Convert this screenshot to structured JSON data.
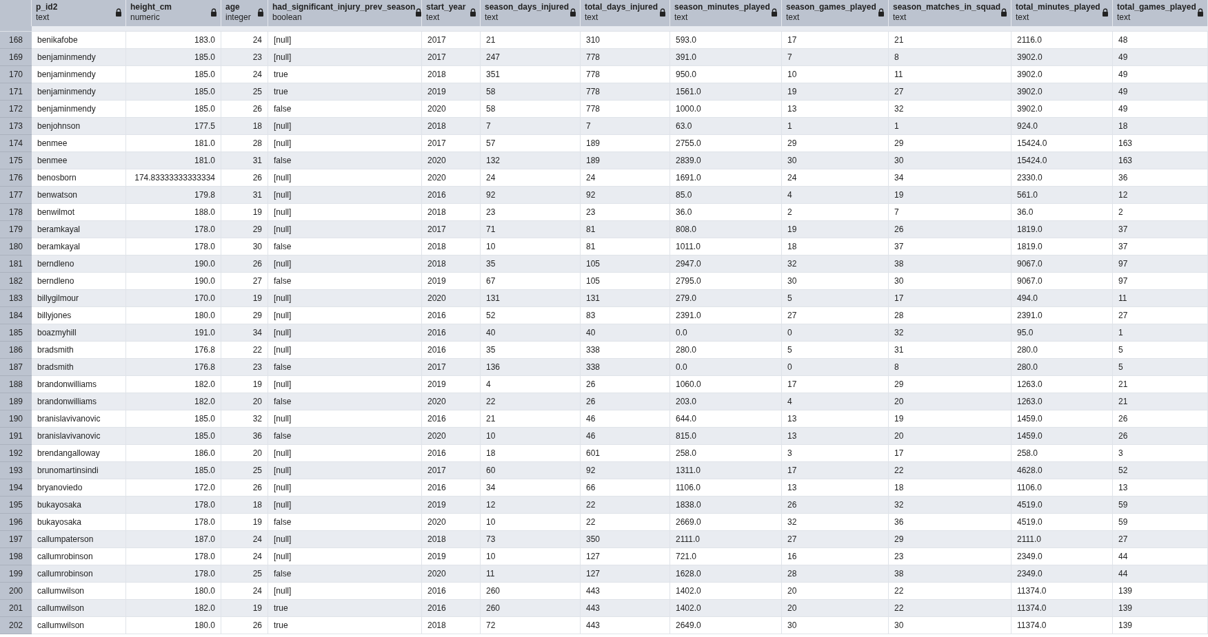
{
  "table": {
    "columns": [
      {
        "name": "p_id2",
        "type": "text",
        "kind": "text"
      },
      {
        "name": "height_cm",
        "type": "numeric",
        "kind": "number"
      },
      {
        "name": "age",
        "type": "integer",
        "kind": "number"
      },
      {
        "name": "had_significant_injury_prev_season",
        "type": "boolean",
        "kind": "text"
      },
      {
        "name": "start_year",
        "type": "text",
        "kind": "text"
      },
      {
        "name": "season_days_injured",
        "type": "text",
        "kind": "text"
      },
      {
        "name": "total_days_injured",
        "type": "text",
        "kind": "text"
      },
      {
        "name": "season_minutes_played",
        "type": "text",
        "kind": "text"
      },
      {
        "name": "season_games_played",
        "type": "text",
        "kind": "text"
      },
      {
        "name": "season_matches_in_squad",
        "type": "text",
        "kind": "text"
      },
      {
        "name": "total_minutes_played",
        "type": "text",
        "kind": "text"
      },
      {
        "name": "total_games_played",
        "type": "text",
        "kind": "text"
      }
    ],
    "rows": [
      {
        "number": "168",
        "cells": [
          "benikafobe",
          "183.0",
          "24",
          "[null]",
          "2017",
          "21",
          "310",
          "593.0",
          "17",
          "21",
          "2116.0",
          "48"
        ]
      },
      {
        "number": "169",
        "cells": [
          "benjaminmendy",
          "185.0",
          "23",
          "[null]",
          "2017",
          "247",
          "778",
          "391.0",
          "7",
          "8",
          "3902.0",
          "49"
        ]
      },
      {
        "number": "170",
        "cells": [
          "benjaminmendy",
          "185.0",
          "24",
          "true",
          "2018",
          "351",
          "778",
          "950.0",
          "10",
          "11",
          "3902.0",
          "49"
        ]
      },
      {
        "number": "171",
        "cells": [
          "benjaminmendy",
          "185.0",
          "25",
          "true",
          "2019",
          "58",
          "778",
          "1561.0",
          "19",
          "27",
          "3902.0",
          "49"
        ]
      },
      {
        "number": "172",
        "cells": [
          "benjaminmendy",
          "185.0",
          "26",
          "false",
          "2020",
          "58",
          "778",
          "1000.0",
          "13",
          "32",
          "3902.0",
          "49"
        ]
      },
      {
        "number": "173",
        "cells": [
          "benjohnson",
          "177.5",
          "18",
          "[null]",
          "2018",
          "7",
          "7",
          "63.0",
          "1",
          "1",
          "924.0",
          "18"
        ]
      },
      {
        "number": "174",
        "cells": [
          "benmee",
          "181.0",
          "28",
          "[null]",
          "2017",
          "57",
          "189",
          "2755.0",
          "29",
          "29",
          "15424.0",
          "163"
        ]
      },
      {
        "number": "175",
        "cells": [
          "benmee",
          "181.0",
          "31",
          "false",
          "2020",
          "132",
          "189",
          "2839.0",
          "30",
          "30",
          "15424.0",
          "163"
        ]
      },
      {
        "number": "176",
        "cells": [
          "benosborn",
          "174.83333333333334",
          "26",
          "[null]",
          "2020",
          "24",
          "24",
          "1691.0",
          "24",
          "34",
          "2330.0",
          "36"
        ]
      },
      {
        "number": "177",
        "cells": [
          "benwatson",
          "179.8",
          "31",
          "[null]",
          "2016",
          "92",
          "92",
          "85.0",
          "4",
          "19",
          "561.0",
          "12"
        ]
      },
      {
        "number": "178",
        "cells": [
          "benwilmot",
          "188.0",
          "19",
          "[null]",
          "2018",
          "23",
          "23",
          "36.0",
          "2",
          "7",
          "36.0",
          "2"
        ]
      },
      {
        "number": "179",
        "cells": [
          "beramkayal",
          "178.0",
          "29",
          "[null]",
          "2017",
          "71",
          "81",
          "808.0",
          "19",
          "26",
          "1819.0",
          "37"
        ]
      },
      {
        "number": "180",
        "cells": [
          "beramkayal",
          "178.0",
          "30",
          "false",
          "2018",
          "10",
          "81",
          "1011.0",
          "18",
          "37",
          "1819.0",
          "37"
        ]
      },
      {
        "number": "181",
        "cells": [
          "berndleno",
          "190.0",
          "26",
          "[null]",
          "2018",
          "35",
          "105",
          "2947.0",
          "32",
          "38",
          "9067.0",
          "97"
        ]
      },
      {
        "number": "182",
        "cells": [
          "berndleno",
          "190.0",
          "27",
          "false",
          "2019",
          "67",
          "105",
          "2795.0",
          "30",
          "30",
          "9067.0",
          "97"
        ]
      },
      {
        "number": "183",
        "cells": [
          "billygilmour",
          "170.0",
          "19",
          "[null]",
          "2020",
          "131",
          "131",
          "279.0",
          "5",
          "17",
          "494.0",
          "11"
        ]
      },
      {
        "number": "184",
        "cells": [
          "billyjones",
          "180.0",
          "29",
          "[null]",
          "2016",
          "52",
          "83",
          "2391.0",
          "27",
          "28",
          "2391.0",
          "27"
        ]
      },
      {
        "number": "185",
        "cells": [
          "boazmyhill",
          "191.0",
          "34",
          "[null]",
          "2016",
          "40",
          "40",
          "0.0",
          "0",
          "32",
          "95.0",
          "1"
        ]
      },
      {
        "number": "186",
        "cells": [
          "bradsmith",
          "176.8",
          "22",
          "[null]",
          "2016",
          "35",
          "338",
          "280.0",
          "5",
          "31",
          "280.0",
          "5"
        ]
      },
      {
        "number": "187",
        "cells": [
          "bradsmith",
          "176.8",
          "23",
          "false",
          "2017",
          "136",
          "338",
          "0.0",
          "0",
          "8",
          "280.0",
          "5"
        ]
      },
      {
        "number": "188",
        "cells": [
          "brandonwilliams",
          "182.0",
          "19",
          "[null]",
          "2019",
          "4",
          "26",
          "1060.0",
          "17",
          "29",
          "1263.0",
          "21"
        ]
      },
      {
        "number": "189",
        "cells": [
          "brandonwilliams",
          "182.0",
          "20",
          "false",
          "2020",
          "22",
          "26",
          "203.0",
          "4",
          "20",
          "1263.0",
          "21"
        ]
      },
      {
        "number": "190",
        "cells": [
          "branislavivanovic",
          "185.0",
          "32",
          "[null]",
          "2016",
          "21",
          "46",
          "644.0",
          "13",
          "19",
          "1459.0",
          "26"
        ]
      },
      {
        "number": "191",
        "cells": [
          "branislavivanovic",
          "185.0",
          "36",
          "false",
          "2020",
          "10",
          "46",
          "815.0",
          "13",
          "20",
          "1459.0",
          "26"
        ]
      },
      {
        "number": "192",
        "cells": [
          "brendangalloway",
          "186.0",
          "20",
          "[null]",
          "2016",
          "18",
          "601",
          "258.0",
          "3",
          "17",
          "258.0",
          "3"
        ]
      },
      {
        "number": "193",
        "cells": [
          "brunomartinsindi",
          "185.0",
          "25",
          "[null]",
          "2017",
          "60",
          "92",
          "1311.0",
          "17",
          "22",
          "4628.0",
          "52"
        ]
      },
      {
        "number": "194",
        "cells": [
          "bryanoviedo",
          "172.0",
          "26",
          "[null]",
          "2016",
          "34",
          "66",
          "1106.0",
          "13",
          "18",
          "1106.0",
          "13"
        ]
      },
      {
        "number": "195",
        "cells": [
          "bukayosaka",
          "178.0",
          "18",
          "[null]",
          "2019",
          "12",
          "22",
          "1838.0",
          "26",
          "32",
          "4519.0",
          "59"
        ]
      },
      {
        "number": "196",
        "cells": [
          "bukayosaka",
          "178.0",
          "19",
          "false",
          "2020",
          "10",
          "22",
          "2669.0",
          "32",
          "36",
          "4519.0",
          "59"
        ]
      },
      {
        "number": "197",
        "cells": [
          "callumpaterson",
          "187.0",
          "24",
          "[null]",
          "2018",
          "73",
          "350",
          "2111.0",
          "27",
          "29",
          "2111.0",
          "27"
        ]
      },
      {
        "number": "198",
        "cells": [
          "callumrobinson",
          "178.0",
          "24",
          "[null]",
          "2019",
          "10",
          "127",
          "721.0",
          "16",
          "23",
          "2349.0",
          "44"
        ]
      },
      {
        "number": "199",
        "cells": [
          "callumrobinson",
          "178.0",
          "25",
          "false",
          "2020",
          "11",
          "127",
          "1628.0",
          "28",
          "38",
          "2349.0",
          "44"
        ]
      },
      {
        "number": "200",
        "cells": [
          "callumwilson",
          "180.0",
          "24",
          "[null]",
          "2016",
          "260",
          "443",
          "1402.0",
          "20",
          "22",
          "11374.0",
          "139"
        ]
      },
      {
        "number": "201",
        "cells": [
          "callumwilson",
          "182.0",
          "19",
          "true",
          "2016",
          "260",
          "443",
          "1402.0",
          "20",
          "22",
          "11374.0",
          "139"
        ]
      },
      {
        "number": "202",
        "cells": [
          "callumwilson",
          "180.0",
          "26",
          "true",
          "2018",
          "72",
          "443",
          "2649.0",
          "30",
          "30",
          "11374.0",
          "139"
        ]
      }
    ]
  }
}
